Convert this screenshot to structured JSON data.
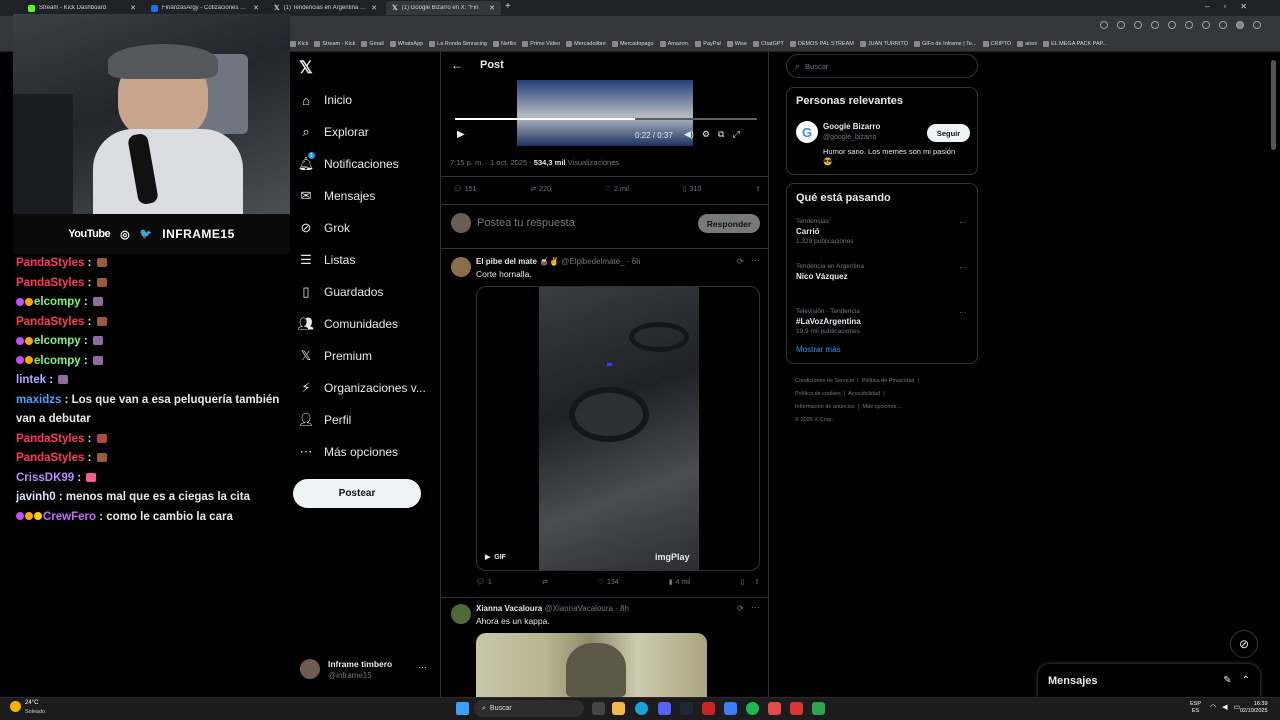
{
  "browser": {
    "tabs": [
      {
        "title": "Stream - Kick Dashboard",
        "color": "#53fc18",
        "active": false
      },
      {
        "title": "FinanzasArgy - Cotizaciones en ti",
        "color": "#1a73e8",
        "active": false
      },
      {
        "title": "(1) Tendencias en Argentina (@p",
        "color": "#ffffff",
        "active": false
      },
      {
        "title": "(1) Google Bizarro en X: \"Fin",
        "color": "#ffffff",
        "active": true
      }
    ],
    "new_tab": "+",
    "bookmarks": [
      "Kick",
      "Stream - Kick",
      "Gmail",
      "WhatsApp",
      "La Ronda Simracing",
      "Netflix",
      "Prime Video",
      "Mercadolibre",
      "Mercadopago",
      "Amazon.",
      "PayPal",
      "Wise",
      "ChatGPT",
      "DEMOS PAL STREAM",
      "JUAN TURRITO",
      "GIFs de Inframe | Te...",
      "CRIPTO",
      "aires",
      "EL MEGA PACK PAP..."
    ]
  },
  "stream": {
    "brand_youtube": "YouTube",
    "handle": "INFRAME15",
    "chat": [
      {
        "user": "PandaStyles",
        "color": "#ff3b5c",
        "badges": 0,
        "text": "",
        "emote": "#9b5a3c"
      },
      {
        "user": "PandaStyles",
        "color": "#ff3b5c",
        "badges": 0,
        "text": "",
        "emote": "#9b5a3c"
      },
      {
        "user": "elcompy",
        "color": "#7cf57a",
        "badges": 2,
        "text": "",
        "emote": "#8e6c9e"
      },
      {
        "user": "PandaStyles",
        "color": "#ff3b5c",
        "badges": 0,
        "text": "",
        "emote": "#9b5a3c"
      },
      {
        "user": "elcompy",
        "color": "#7cf57a",
        "badges": 2,
        "text": "",
        "emote": "#8e6c9e"
      },
      {
        "user": "elcompy",
        "color": "#7cf57a",
        "badges": 2,
        "text": "",
        "emote": "#8e6c9e"
      },
      {
        "user": "lintek",
        "color": "#b6a6ff",
        "badges": 0,
        "text": "",
        "emote": "#8e6c9e"
      },
      {
        "user": "maxidzs",
        "color": "#4aa3ff",
        "badges": 0,
        "text": "Los que van a esa peluquería también van a debutar",
        "emote": ""
      },
      {
        "user": "PandaStyles",
        "color": "#ff3b5c",
        "badges": 0,
        "text": "",
        "emote": "#b04a3c"
      },
      {
        "user": "PandaStyles",
        "color": "#ff3b5c",
        "badges": 0,
        "text": "",
        "emote": "#9b5a3c"
      },
      {
        "user": "CrissDK99",
        "color": "#b98cff",
        "badges": 0,
        "text": "",
        "emote": "#ff5d8a"
      },
      {
        "user": "javinh0",
        "color": "#d7e3ff",
        "badges": 0,
        "text": "menos mal que es a ciegas la cita",
        "emote": ""
      },
      {
        "user": "CrewFero",
        "color": "#c86bff",
        "badges": 3,
        "text": "como le cambio la cara",
        "emote": ""
      }
    ]
  },
  "nav": {
    "items": [
      "Inicio",
      "Explorar",
      "Notificaciones",
      "Mensajes",
      "Grok",
      "Listas",
      "Guardados",
      "Comunidades",
      "Premium",
      "Organizaciones v...",
      "Perfil",
      "Más opciones"
    ],
    "notif_badge": "1",
    "post_button": "Postear",
    "account_name": "Inframe timbero",
    "account_handle": "@inframe15"
  },
  "post": {
    "header": "Post",
    "video_time": "0:22 / 0:37",
    "timestamp": "7:15 p. m. · 1 oct. 2025 · ",
    "views_count": "534,3 mil",
    "views_label": "Visualizaciones",
    "stats": {
      "replies": "151",
      "reposts": "220",
      "likes": "2 mil",
      "bookmarks": "310"
    },
    "reply_placeholder": "Postea tu respuesta",
    "reply_button": "Responder"
  },
  "replies": [
    {
      "name": "El pibe del mate",
      "emojis": "🧉✌",
      "handle": "@Elpibedelmate_",
      "time": "· 6h",
      "text": "Corte hornalla.",
      "gif_label": "GIF",
      "watermark": "imgPlay",
      "replies": "1",
      "likes": "134",
      "views": "4 mil"
    },
    {
      "name": "Xianna Vacaloura",
      "emojis": "",
      "handle": "@XiannaVacaloura",
      "time": "· 8h",
      "text": "Ahora es un kappa."
    }
  ],
  "right": {
    "search_placeholder": "Buscar",
    "relevant_title": "Personas relevantes",
    "person_name": "Google Bizarro",
    "person_handle": "@google_bizarro",
    "person_bio": "Humor sano. Los memes son mi pasión 😎",
    "follow_button": "Seguir",
    "happening_title": "Qué está pasando",
    "trends": [
      {
        "context": "Tendencias",
        "name": "Carrió",
        "count": "1.329 publicaciones"
      },
      {
        "context": "Tendencia en Argentina",
        "name": "Nico Vázquez",
        "count": ""
      },
      {
        "context": "Televisión · Tendencia",
        "name": "#LaVozArgentina",
        "count": "19,9 mil publicaciones"
      }
    ],
    "show_more": "Mostrar más",
    "footer": [
      "Condiciones de Servicio",
      "Política de Privacidad",
      "Política de cookies",
      "Accesibilidad",
      "Información de anuncios",
      "Más opciones ...",
      "© 2025 X Corp."
    ],
    "messages_drawer": "Mensajes"
  },
  "taskbar": {
    "weather_temp": "24°C",
    "weather_desc": "Soleado",
    "search": "Buscar",
    "lang1": "ESP",
    "lang2": "ES",
    "time": "16:39",
    "date": "02/10/2025"
  }
}
